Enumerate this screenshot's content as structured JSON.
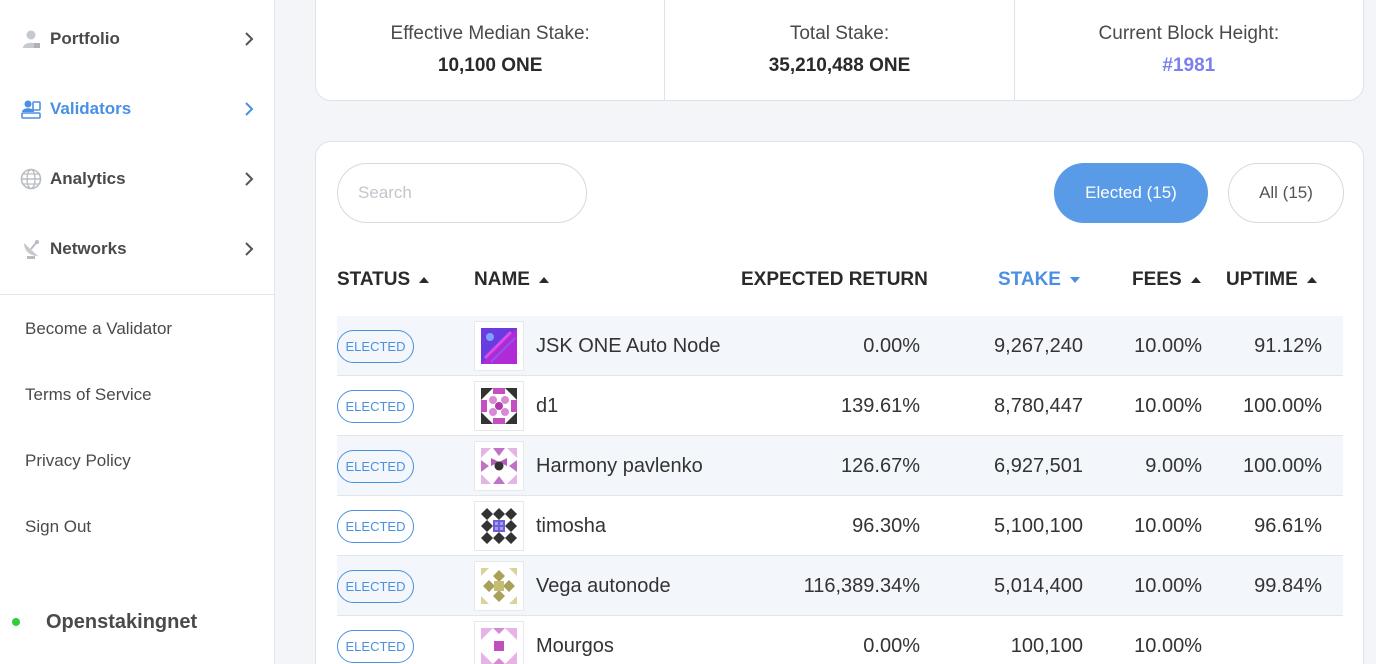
{
  "sidebar": {
    "nav": [
      {
        "label": "Portfolio",
        "icon": "user-icon",
        "active": false
      },
      {
        "label": "Validators",
        "icon": "validators-icon",
        "active": true
      },
      {
        "label": "Analytics",
        "icon": "globe-icon",
        "active": false
      },
      {
        "label": "Networks",
        "icon": "satellite-icon",
        "active": false
      }
    ],
    "links": [
      "Become a Validator",
      "Terms of Service",
      "Privacy Policy",
      "Sign Out"
    ],
    "network": {
      "label": "Openstakingnet",
      "status_color": "#2fcc3b"
    }
  },
  "stats": {
    "median": {
      "label": "Effective Median Stake:",
      "value": "10,100 ONE"
    },
    "total": {
      "label": "Total Stake:",
      "value": "35,210,488 ONE"
    },
    "block": {
      "label": "Current Block Height:",
      "value": "#1981"
    }
  },
  "table": {
    "search_placeholder": "Search",
    "filters": {
      "elected": "Elected (15)",
      "all": "All (15)"
    },
    "headers": {
      "status": "STATUS",
      "name": "NAME",
      "expected_return": "EXPECTED RETURN",
      "stake": "STAKE",
      "fees": "FEES",
      "uptime": "UPTIME"
    },
    "rows": [
      {
        "status": "ELECTED",
        "name": "JSK ONE Auto Node",
        "expected_return": "0.00%",
        "stake": "9,267,240",
        "fees": "10.00%",
        "uptime": "91.12%"
      },
      {
        "status": "ELECTED",
        "name": "d1",
        "expected_return": "139.61%",
        "stake": "8,780,447",
        "fees": "10.00%",
        "uptime": "100.00%"
      },
      {
        "status": "ELECTED",
        "name": "Harmony pavlenko",
        "expected_return": "126.67%",
        "stake": "6,927,501",
        "fees": "9.00%",
        "uptime": "100.00%"
      },
      {
        "status": "ELECTED",
        "name": "timosha",
        "expected_return": "96.30%",
        "stake": "5,100,100",
        "fees": "10.00%",
        "uptime": "96.61%"
      },
      {
        "status": "ELECTED",
        "name": "Vega autonode",
        "expected_return": "116,389.34%",
        "stake": "5,014,400",
        "fees": "10.00%",
        "uptime": "99.84%"
      },
      {
        "status": "ELECTED",
        "name": "Mourgos",
        "expected_return": "0.00%",
        "stake": "100,100",
        "fees": "10.00%",
        "uptime": ""
      }
    ]
  },
  "colors": {
    "accent": "#4a90e2",
    "block_link": "#7b7ff0",
    "filter_active": "#5a9be8"
  }
}
